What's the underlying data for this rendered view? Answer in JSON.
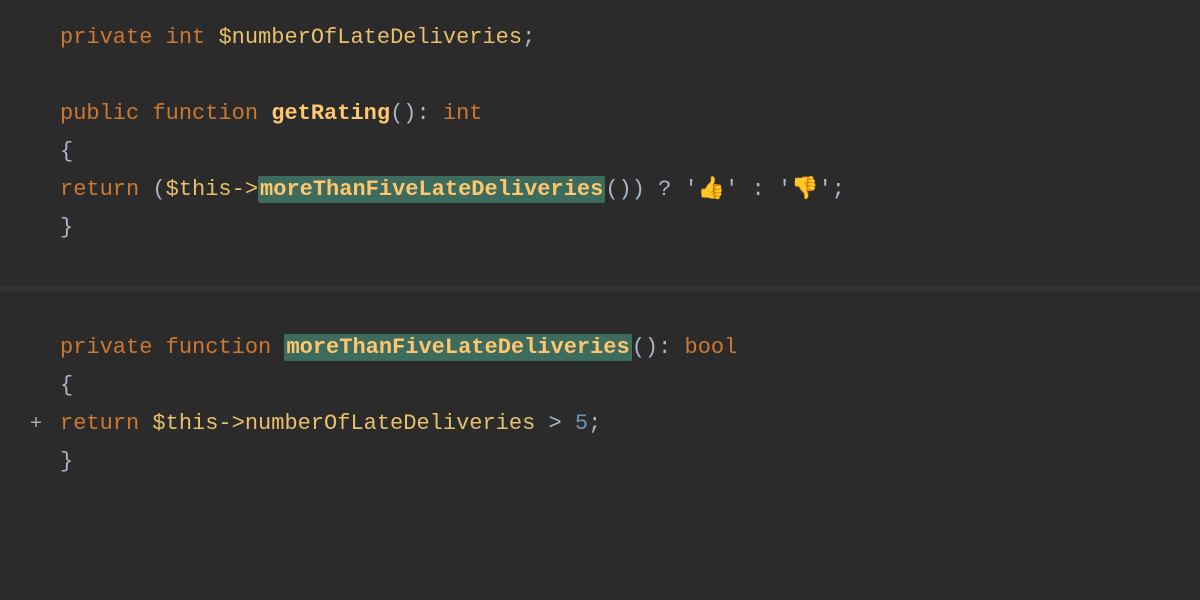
{
  "code": {
    "line1": {
      "gutter": "",
      "parts": [
        {
          "type": "kw-private",
          "text": "private "
        },
        {
          "type": "kw-int",
          "text": "int "
        },
        {
          "type": "var-dollar",
          "text": "$numberOfLateDeliveries"
        },
        {
          "type": "plain",
          "text": ";"
        }
      ]
    },
    "line2": {
      "gutter": "",
      "parts": []
    },
    "line3": {
      "gutter": "",
      "parts": [
        {
          "type": "kw-public",
          "text": "public "
        },
        {
          "type": "kw-function",
          "text": "function "
        },
        {
          "type": "fn-name",
          "text": "getRating"
        },
        {
          "type": "plain",
          "text": "(): "
        },
        {
          "type": "kw-int",
          "text": "int"
        }
      ]
    },
    "line4": {
      "gutter": "",
      "parts": [
        {
          "type": "brace",
          "text": "{"
        }
      ]
    },
    "line5": {
      "gutter": "",
      "parts": [
        {
          "type": "kw-return",
          "text": "        return "
        },
        {
          "type": "plain",
          "text": "("
        },
        {
          "type": "var-dollar",
          "text": "$this->"
        },
        {
          "type": "highlight",
          "text": "moreThanFiveLateDeliveries"
        },
        {
          "type": "plain",
          "text": "()) ? '"
        },
        {
          "type": "emoji",
          "text": "👍"
        },
        {
          "type": "plain",
          "text": "' : '"
        },
        {
          "type": "emoji",
          "text": "👎"
        },
        {
          "type": "plain",
          "text": "';"
        }
      ]
    },
    "line6": {
      "gutter": "",
      "parts": [
        {
          "type": "brace",
          "text": "}"
        }
      ]
    },
    "line7": {
      "gutter": "",
      "parts": []
    },
    "line8": {
      "gutter": "",
      "parts": []
    },
    "line9": {
      "gutter": "",
      "parts": [
        {
          "type": "kw-private",
          "text": "private "
        },
        {
          "type": "kw-function",
          "text": "function "
        },
        {
          "type": "highlight",
          "text": "moreThanFiveLateDeliveries"
        },
        {
          "type": "plain",
          "text": "(): "
        },
        {
          "type": "kw-bool",
          "text": "bool"
        }
      ]
    },
    "line10": {
      "gutter": "",
      "parts": [
        {
          "type": "brace",
          "text": "{"
        }
      ]
    },
    "line11": {
      "gutter": "",
      "parts": [
        {
          "type": "kw-return",
          "text": "        return "
        },
        {
          "type": "var-dollar",
          "text": "$this->numberOfLateDeliveries"
        },
        {
          "type": "plain",
          "text": " > "
        },
        {
          "type": "number",
          "text": "5"
        },
        {
          "type": "plain",
          "text": ";"
        }
      ]
    },
    "line12": {
      "gutter": "",
      "parts": [
        {
          "type": "brace",
          "text": "}"
        }
      ]
    }
  },
  "colors": {
    "bg": "#2b2b2b",
    "accent": "#cc7832",
    "highlight_bg": "#3d6b5e"
  }
}
